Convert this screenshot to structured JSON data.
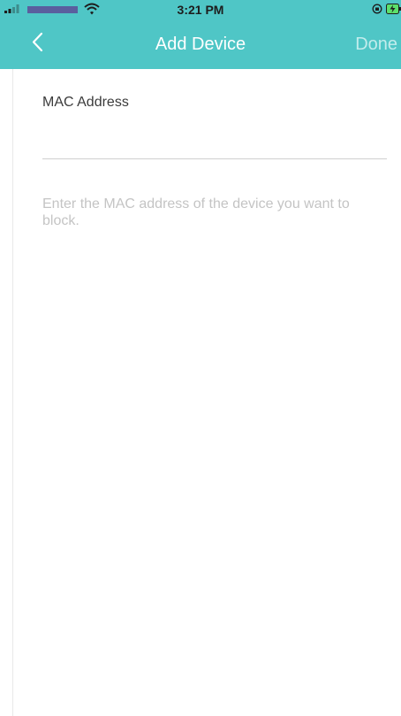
{
  "status_bar": {
    "time": "3:21 PM",
    "icons": [
      "signal-icon",
      "wifi-icon",
      "orientation-lock-icon",
      "battery-charging-icon"
    ]
  },
  "nav": {
    "back_icon": "chevron-left-icon",
    "title": "Add Device",
    "done_label": "Done"
  },
  "form": {
    "mac_label": "MAC Address",
    "mac_value": "",
    "mac_placeholder": "",
    "hint": "Enter the MAC address of the device you want to block."
  },
  "colors": {
    "header_bg": "#4fc6c6",
    "title_text": "#ffffff",
    "done_disabled_text": "#c2ecec",
    "label_text": "#3b3b3b",
    "hint_text": "#c4c4c4",
    "divider": "#cfcfcf"
  }
}
